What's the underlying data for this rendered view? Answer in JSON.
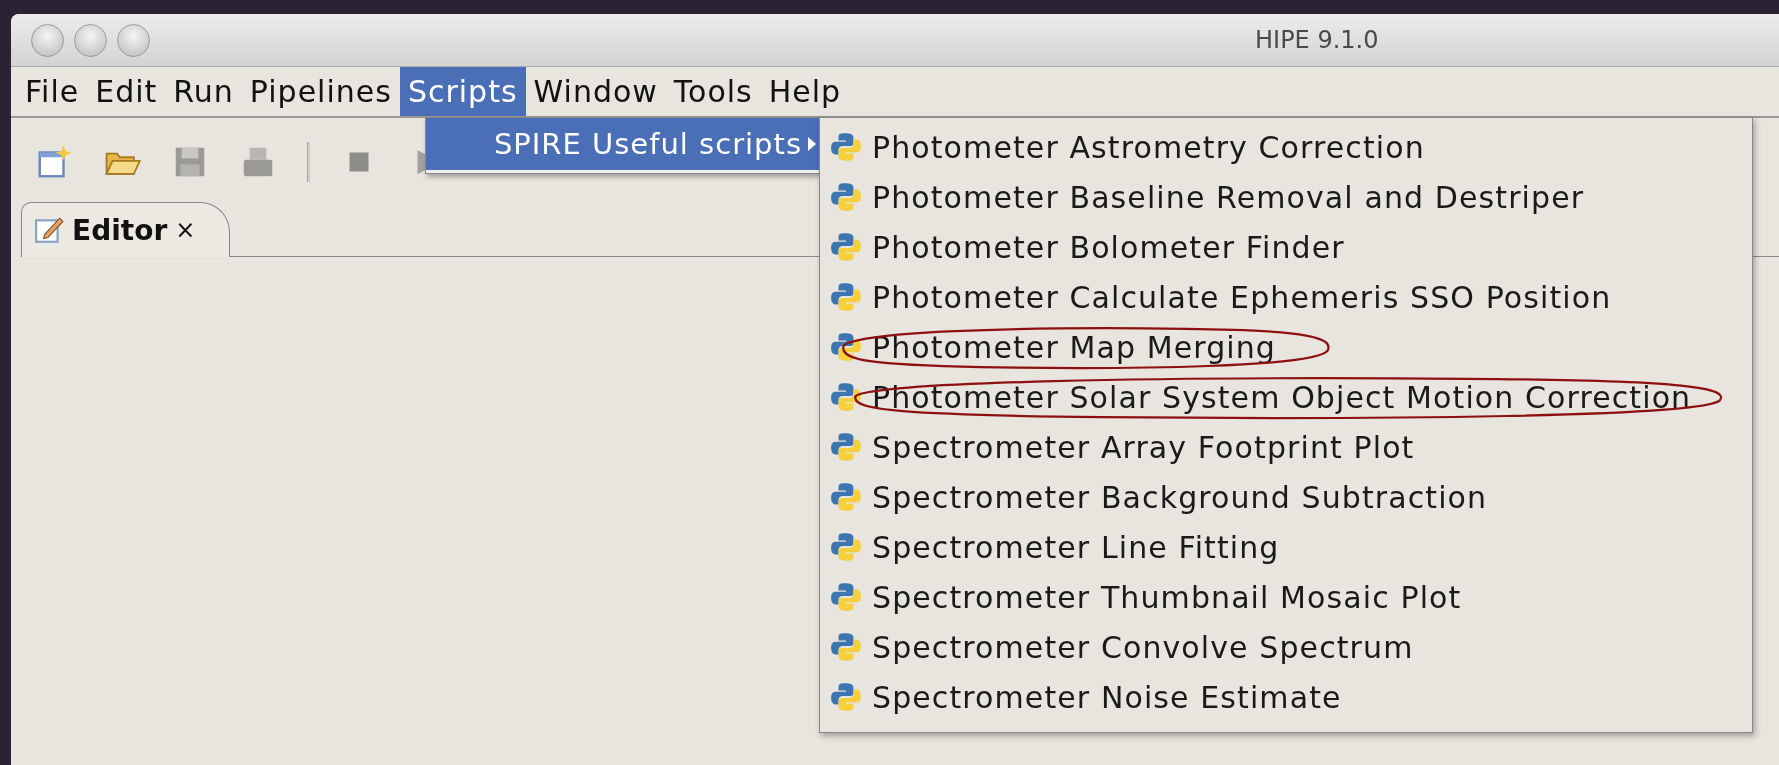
{
  "window": {
    "title": "HIPE 9.1.0"
  },
  "menu_bar": [
    {
      "label": "File",
      "selected": false
    },
    {
      "label": "Edit",
      "selected": false
    },
    {
      "label": "Run",
      "selected": false
    },
    {
      "label": "Pipelines",
      "selected": false
    },
    {
      "label": "Scripts",
      "selected": true
    },
    {
      "label": "Window",
      "selected": false
    },
    {
      "label": "Tools",
      "selected": false
    },
    {
      "label": "Help",
      "selected": false
    }
  ],
  "toolbar": [
    {
      "kind": "new"
    },
    {
      "kind": "open"
    },
    {
      "kind": "save"
    },
    {
      "kind": "print"
    },
    {
      "kind": "separator"
    },
    {
      "kind": "stop"
    },
    {
      "kind": "run"
    }
  ],
  "tabs": [
    {
      "label": "Editor",
      "close": "×"
    }
  ],
  "scripts_menu": [
    {
      "label": "SPIRE Useful scripts",
      "selected": true
    }
  ],
  "submenu": [
    {
      "label": "Photometer Astrometry Correction",
      "circled": false
    },
    {
      "label": "Photometer Baseline Removal and Destriper",
      "circled": false
    },
    {
      "label": "Photometer Bolometer Finder",
      "circled": false
    },
    {
      "label": "Photometer Calculate Ephemeris SSO Position",
      "circled": false
    },
    {
      "label": "Photometer Map Merging",
      "circled": true
    },
    {
      "label": "Photometer Solar System Object Motion Correction",
      "circled": true
    },
    {
      "label": "Spectrometer Array Footprint Plot",
      "circled": false
    },
    {
      "label": "Spectrometer Background Subtraction",
      "circled": false
    },
    {
      "label": "Spectrometer Line Fitting",
      "circled": false
    },
    {
      "label": "Spectrometer Thumbnail Mosaic Plot",
      "circled": false
    },
    {
      "label": "Spectrometer Convolve Spectrum",
      "circled": false
    },
    {
      "label": "Spectrometer Noise Estimate",
      "circled": false
    }
  ]
}
